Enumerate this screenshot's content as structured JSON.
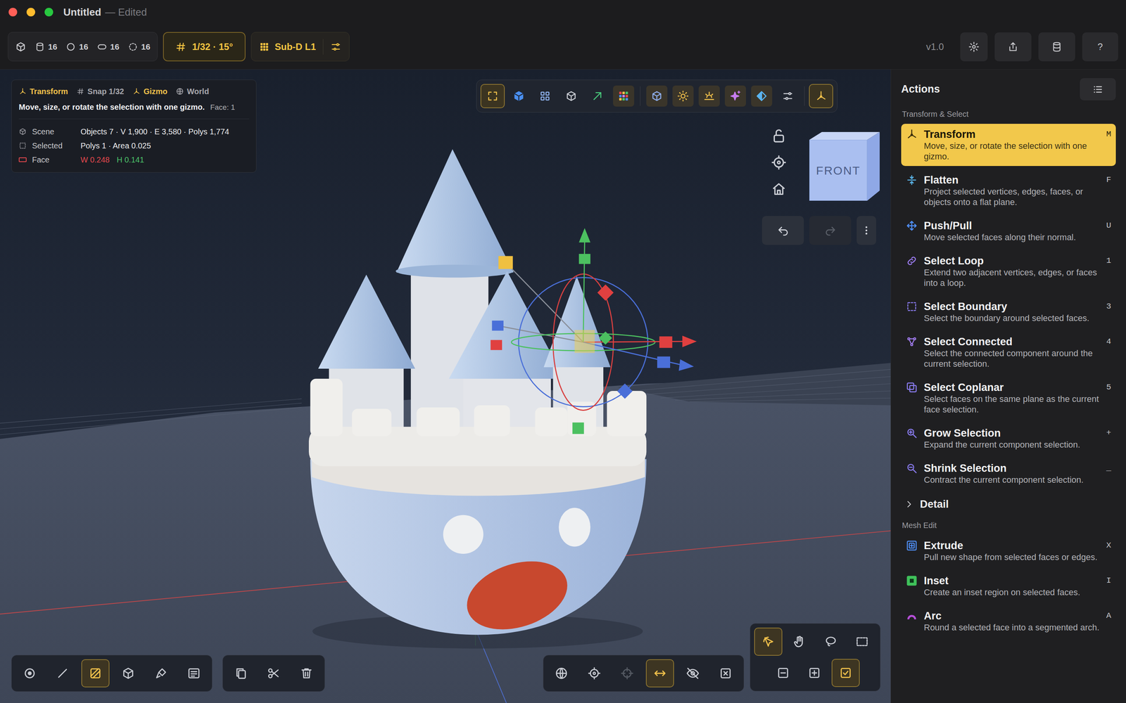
{
  "window": {
    "title": "Untitled",
    "subtitle": "— Edited"
  },
  "toolbar": {
    "primitives": [
      "16",
      "16",
      "16",
      "16"
    ],
    "snap": "1/32 · 15°",
    "subdivision": "Sub-D L1",
    "version": "v1.0",
    "help": "?"
  },
  "info": {
    "mode": "Transform",
    "snap": "Snap 1/32",
    "gizmo": "Gizmo",
    "space": "World",
    "hint": "Move, size, or rotate the selection with one gizmo.",
    "face_count": "Face: 1",
    "stats": [
      {
        "label": "Scene",
        "value": "Objects 7 · V 1,900 · E 3,580 · Polys 1,774"
      },
      {
        "label": "Selected",
        "value": "Polys 1 · Area 0.025"
      }
    ],
    "face": {
      "label": "Face",
      "width": "W 0.248",
      "height": "H 0.141"
    }
  },
  "viewport_toolbar": [
    {
      "selected": true,
      "on": false
    },
    {
      "selected": false,
      "on": false
    },
    {
      "selected": false,
      "on": false
    },
    {
      "selected": false,
      "on": false
    },
    {
      "selected": false,
      "on": false
    },
    {
      "selected": false,
      "on": true
    },
    {
      "selected": false,
      "on": true
    },
    {
      "selected": false,
      "on": true
    },
    {
      "selected": false,
      "on": true
    },
    {
      "selected": false,
      "on": true
    },
    {
      "selected": false,
      "on": true
    },
    {
      "selected": false,
      "on": false
    },
    {
      "selected": true,
      "on": false
    }
  ],
  "view_cube": {
    "label": "FRONT"
  },
  "history": {
    "undo_disabled": false,
    "redo_disabled": true
  },
  "modes": [
    {
      "selected": false
    },
    {
      "selected": false
    },
    {
      "selected": true
    },
    {
      "selected": false
    },
    {
      "selected": false
    },
    {
      "selected": false
    }
  ],
  "edit_actions": [
    {
      "selected": false
    },
    {
      "selected": false
    },
    {
      "selected": false
    }
  ],
  "view_toggles": [
    {
      "selected": false,
      "disabled": false
    },
    {
      "selected": false,
      "disabled": false
    },
    {
      "selected": false,
      "disabled": true
    },
    {
      "selected": true,
      "disabled": false
    },
    {
      "selected": false,
      "disabled": false
    },
    {
      "selected": false,
      "disabled": false
    }
  ],
  "select_tools": [
    {
      "selected": true
    },
    {
      "selected": false
    },
    {
      "selected": false
    },
    {
      "selected": false
    }
  ],
  "select_ops": [
    {
      "selected": false
    },
    {
      "selected": false
    },
    {
      "selected": true
    }
  ],
  "panel": {
    "title": "Actions",
    "groups": [
      {
        "kind": "section",
        "label": "Transform & Select",
        "items": [
          {
            "title": "Transform",
            "description": "Move, size, or rotate the selection with one gizmo.",
            "shortcut": "M",
            "selected": true,
            "color": "#3a2e0a"
          },
          {
            "title": "Flatten",
            "description": "Project selected vertices, edges, faces, or objects onto a flat plane.",
            "shortcut": "F",
            "selected": false,
            "color": "#5ab4e8"
          },
          {
            "title": "Push/Pull",
            "description": "Move selected faces along their normal.",
            "shortcut": "U",
            "selected": false,
            "color": "#4f8ff7"
          },
          {
            "title": "Select Loop",
            "description": "Extend two adjacent vertices, edges, or faces into a loop.",
            "shortcut": "1",
            "selected": false,
            "color": "#9b7bf0"
          },
          {
            "title": "Select Boundary",
            "description": "Select the boundary around selected faces.",
            "shortcut": "3",
            "selected": false,
            "color": "#8a7cf0"
          },
          {
            "title": "Select Connected",
            "description": "Select the connected component around the current selection.",
            "shortcut": "4",
            "selected": false,
            "color": "#a27cf0"
          },
          {
            "title": "Select Coplanar",
            "description": "Select faces on the same plane as the current face selection.",
            "shortcut": "5",
            "selected": false,
            "color": "#8a7cf0"
          },
          {
            "title": "Grow Selection",
            "description": "Expand the current component selection.",
            "shortcut": "+",
            "selected": false,
            "color": "#8a7cf0"
          },
          {
            "title": "Shrink Selection",
            "description": "Contract the current component selection.",
            "shortcut": "_",
            "selected": false,
            "color": "#8a7cf0"
          }
        ]
      },
      {
        "kind": "collapsible",
        "label": "Detail",
        "expanded": false
      },
      {
        "kind": "section",
        "label": "Mesh Edit",
        "items": [
          {
            "title": "Extrude",
            "description": "Pull new shape from selected faces or edges.",
            "shortcut": "X",
            "selected": false,
            "color": "#4f8ff7"
          },
          {
            "title": "Inset",
            "description": "Create an inset region on selected faces.",
            "shortcut": "I",
            "selected": false,
            "color": "#3fc15a"
          },
          {
            "title": "Arc",
            "description": "Round a selected face into a segmented arch.",
            "shortcut": "A",
            "selected": false,
            "color": "#b54fd8"
          }
        ]
      }
    ]
  }
}
